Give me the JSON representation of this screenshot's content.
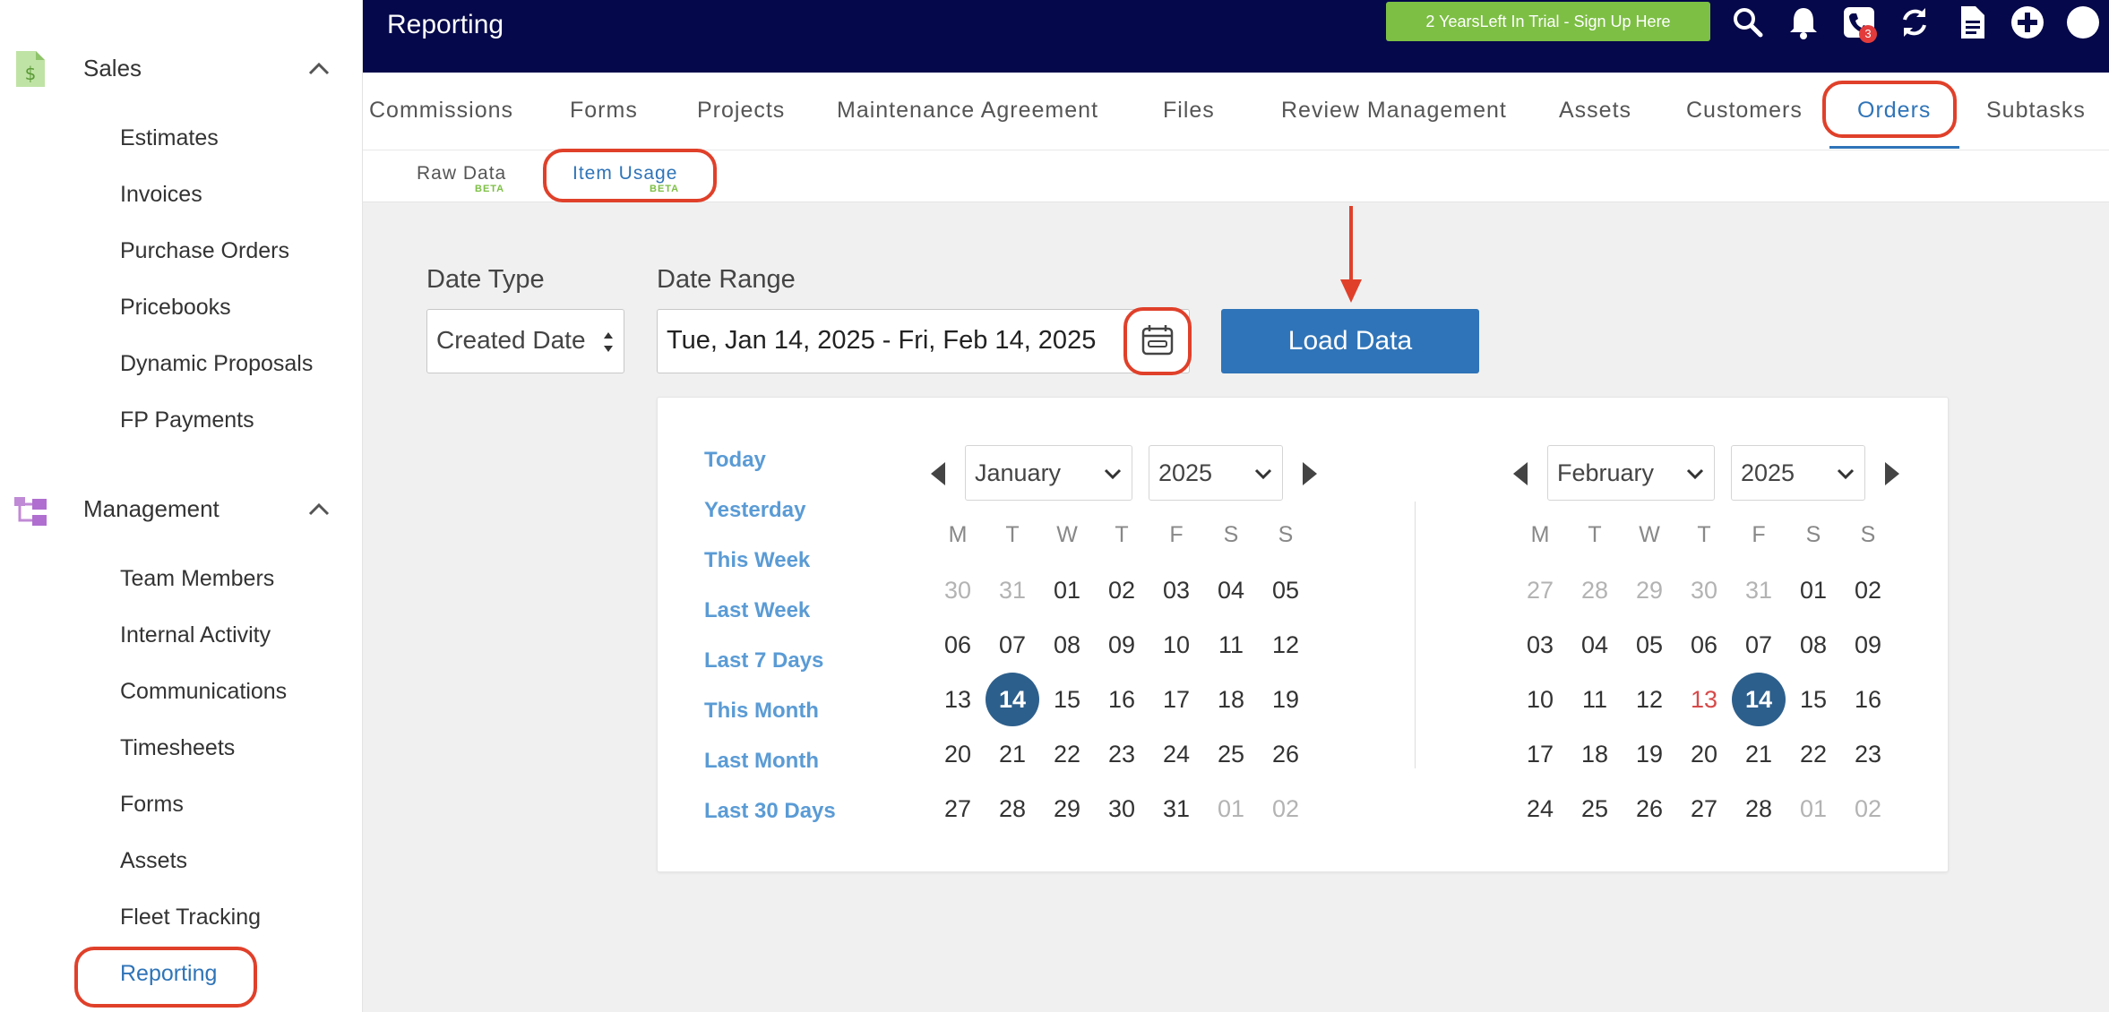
{
  "sidebar": {
    "sales": {
      "title": "Sales",
      "items": [
        "Estimates",
        "Invoices",
        "Purchase Orders",
        "Pricebooks",
        "Dynamic Proposals",
        "FP Payments"
      ]
    },
    "management": {
      "title": "Management",
      "items": [
        "Team Members",
        "Internal Activity",
        "Communications",
        "Timesheets",
        "Forms",
        "Assets",
        "Fleet Tracking",
        "Reporting"
      ],
      "active_item": "Reporting"
    }
  },
  "topbar": {
    "title": "Reporting",
    "trial_label": "2 YearsLeft In Trial - Sign Up Here",
    "phone_badge": "3",
    "icons": [
      "search-icon",
      "bell-icon",
      "phone-icon",
      "sync-icon",
      "document-icon",
      "plus-circle-icon"
    ]
  },
  "nav_tabs": [
    "Commissions",
    "Forms",
    "Projects",
    "Maintenance Agreement",
    "Files",
    "Review Management",
    "Assets",
    "Customers",
    "Orders",
    "Subtasks"
  ],
  "nav_active": "Orders",
  "sub_tabs": [
    {
      "label": "Raw Data",
      "badge": "BETA"
    },
    {
      "label": "Item Usage",
      "badge": "BETA"
    }
  ],
  "sub_active": "Item Usage",
  "filters": {
    "date_type_label": "Date Type",
    "date_type_value": "Created Date",
    "date_range_label": "Date Range",
    "date_range_value": "Tue, Jan 14, 2025 - Fri, Feb 14, 2025",
    "load_button": "Load Data"
  },
  "calendar": {
    "presets": [
      "Today",
      "Yesterday",
      "This Week",
      "Last Week",
      "Last 7 Days",
      "This Month",
      "Last Month",
      "Last 30 Days"
    ],
    "weekdays": [
      "M",
      "T",
      "W",
      "T",
      "F",
      "S",
      "S"
    ],
    "left": {
      "month": "January",
      "year": "2025",
      "weeks": [
        [
          "30",
          "31",
          "01",
          "02",
          "03",
          "04",
          "05"
        ],
        [
          "06",
          "07",
          "08",
          "09",
          "10",
          "11",
          "12"
        ],
        [
          "13",
          "14",
          "15",
          "16",
          "17",
          "18",
          "19"
        ],
        [
          "20",
          "21",
          "22",
          "23",
          "24",
          "25",
          "26"
        ],
        [
          "27",
          "28",
          "29",
          "30",
          "31",
          "01",
          "02"
        ]
      ],
      "muted": [
        [
          0,
          0
        ],
        [
          0,
          1
        ],
        [
          4,
          5
        ],
        [
          4,
          6
        ]
      ],
      "selected": [
        [
          2,
          1
        ]
      ]
    },
    "right": {
      "month": "February",
      "year": "2025",
      "weeks": [
        [
          "27",
          "28",
          "29",
          "30",
          "31",
          "01",
          "02"
        ],
        [
          "03",
          "04",
          "05",
          "06",
          "07",
          "08",
          "09"
        ],
        [
          "10",
          "11",
          "12",
          "13",
          "14",
          "15",
          "16"
        ],
        [
          "17",
          "18",
          "19",
          "20",
          "21",
          "22",
          "23"
        ],
        [
          "24",
          "25",
          "26",
          "27",
          "28",
          "01",
          "02"
        ]
      ],
      "muted": [
        [
          0,
          0
        ],
        [
          0,
          1
        ],
        [
          0,
          2
        ],
        [
          0,
          3
        ],
        [
          0,
          4
        ],
        [
          4,
          5
        ],
        [
          4,
          6
        ]
      ],
      "selected": [
        [
          2,
          4
        ]
      ],
      "today": [
        [
          2,
          3
        ]
      ]
    }
  },
  "colors": {
    "topbar": "#05084a",
    "accent": "#2f74b8",
    "trial": "#7dbf45",
    "selected_day": "#2d5f8c",
    "annotation": "#e0402a"
  }
}
